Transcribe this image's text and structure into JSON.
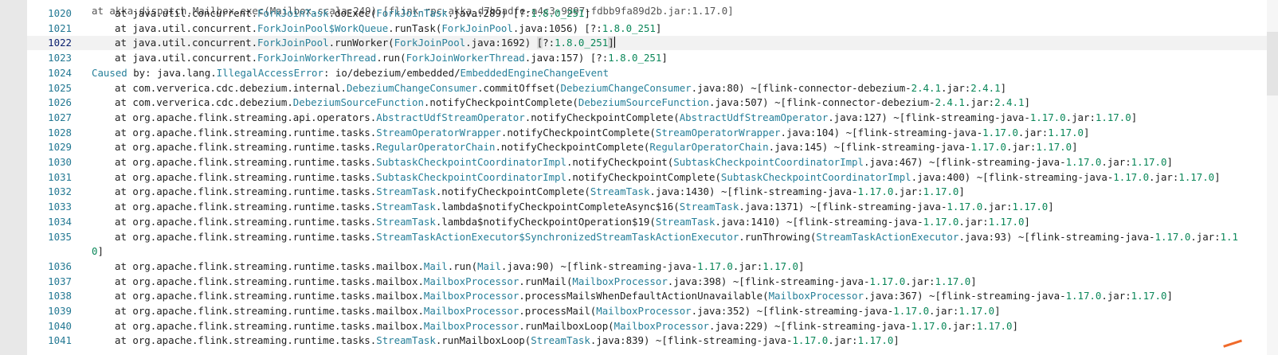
{
  "editor": {
    "top_fragment": "at akka.dispatch.Mailbox.exec(Mailbox.scala:249) [flink-rpc-akka_d7b5adfe-a4c3-9897-fdbb9fa89d2b.jar:1.17.0]",
    "lines": [
      {
        "num": "1020",
        "segs": [
          [
            "",
            "at java.util.concurrent."
          ],
          [
            "c",
            "ForkJoinTask"
          ],
          [
            "",
            ".doExec("
          ],
          [
            "c",
            "ForkJoinTask"
          ],
          [
            "",
            ".java:289) [?:"
          ],
          [
            "n",
            "1.8.0_251"
          ],
          [
            "",
            "]"
          ]
        ]
      },
      {
        "num": "1021",
        "segs": [
          [
            "",
            "at java.util.concurrent."
          ],
          [
            "c",
            "ForkJoinPool$WorkQueue"
          ],
          [
            "",
            ".runTask("
          ],
          [
            "c",
            "ForkJoinPool"
          ],
          [
            "",
            ".java:1056) [?:"
          ],
          [
            "n",
            "1.8.0_251"
          ],
          [
            "",
            "]"
          ]
        ]
      },
      {
        "num": "1022",
        "segs": [
          [
            "",
            "at java.util.concurrent."
          ],
          [
            "c",
            "ForkJoinPool"
          ],
          [
            "",
            ".runWorker("
          ],
          [
            "c",
            "ForkJoinPool"
          ],
          [
            "",
            ".java:1692) "
          ],
          [
            "hl",
            "["
          ],
          [
            "",
            "?:"
          ],
          [
            "n",
            "1.8.0_251"
          ],
          [
            "hl",
            "]"
          ]
        ]
      },
      {
        "num": "1023",
        "segs": [
          [
            "",
            "at java.util.concurrent."
          ],
          [
            "c",
            "ForkJoinWorkerThread"
          ],
          [
            "",
            ".run("
          ],
          [
            "c",
            "ForkJoinWorkerThread"
          ],
          [
            "",
            ".java:157) [?:"
          ],
          [
            "n",
            "1.8.0_251"
          ],
          [
            "",
            "]"
          ]
        ]
      },
      {
        "num": "1024",
        "noindent": true,
        "segs": [
          [
            "c",
            "Caused"
          ],
          [
            "",
            " by: java.lang."
          ],
          [
            "c",
            "IllegalAccessError"
          ],
          [
            "",
            ": io/debezium/embedded/"
          ],
          [
            "c",
            "EmbeddedEngineChangeEvent"
          ]
        ]
      },
      {
        "num": "1025",
        "segs": [
          [
            "",
            "at com.ververica.cdc.debezium.internal."
          ],
          [
            "c",
            "DebeziumChangeConsumer"
          ],
          [
            "",
            ".commitOffset("
          ],
          [
            "c",
            "DebeziumChangeConsumer"
          ],
          [
            "",
            ".java:80) ~[flink-connector-debezium-"
          ],
          [
            "n",
            "2.4.1"
          ],
          [
            "",
            ".jar:"
          ],
          [
            "n",
            "2.4.1"
          ],
          [
            "",
            "]"
          ]
        ]
      },
      {
        "num": "1026",
        "segs": [
          [
            "",
            "at com.ververica.cdc.debezium."
          ],
          [
            "c",
            "DebeziumSourceFunction"
          ],
          [
            "",
            ".notifyCheckpointComplete("
          ],
          [
            "c",
            "DebeziumSourceFunction"
          ],
          [
            "",
            ".java:507) ~[flink-connector-debezium-"
          ],
          [
            "n",
            "2.4.1"
          ],
          [
            "",
            ".jar:"
          ],
          [
            "n",
            "2.4.1"
          ],
          [
            "",
            "]"
          ]
        ]
      },
      {
        "num": "1027",
        "segs": [
          [
            "",
            "at org.apache.flink.streaming.api.operators."
          ],
          [
            "c",
            "AbstractUdfStreamOperator"
          ],
          [
            "",
            ".notifyCheckpointComplete("
          ],
          [
            "c",
            "AbstractUdfStreamOperator"
          ],
          [
            "",
            ".java:127) ~[flink-streaming-java-"
          ],
          [
            "n",
            "1.17.0"
          ],
          [
            "",
            ".jar:"
          ],
          [
            "n",
            "1.17.0"
          ],
          [
            "",
            "]"
          ]
        ]
      },
      {
        "num": "1028",
        "segs": [
          [
            "",
            "at org.apache.flink.streaming.runtime.tasks."
          ],
          [
            "c",
            "StreamOperatorWrapper"
          ],
          [
            "",
            ".notifyCheckpointComplete("
          ],
          [
            "c",
            "StreamOperatorWrapper"
          ],
          [
            "",
            ".java:104) ~[flink-streaming-java-"
          ],
          [
            "n",
            "1.17.0"
          ],
          [
            "",
            ".jar:"
          ],
          [
            "n",
            "1.17.0"
          ],
          [
            "",
            "]"
          ]
        ]
      },
      {
        "num": "1029",
        "segs": [
          [
            "",
            "at org.apache.flink.streaming.runtime.tasks."
          ],
          [
            "c",
            "RegularOperatorChain"
          ],
          [
            "",
            ".notifyCheckpointComplete("
          ],
          [
            "c",
            "RegularOperatorChain"
          ],
          [
            "",
            ".java:145) ~[flink-streaming-java-"
          ],
          [
            "n",
            "1.17.0"
          ],
          [
            "",
            ".jar:"
          ],
          [
            "n",
            "1.17.0"
          ],
          [
            "",
            "]"
          ]
        ]
      },
      {
        "num": "1030",
        "segs": [
          [
            "",
            "at org.apache.flink.streaming.runtime.tasks."
          ],
          [
            "c",
            "SubtaskCheckpointCoordinatorImpl"
          ],
          [
            "",
            ".notifyCheckpoint("
          ],
          [
            "c",
            "SubtaskCheckpointCoordinatorImpl"
          ],
          [
            "",
            ".java:467) ~[flink-streaming-java-"
          ],
          [
            "n",
            "1.17.0"
          ],
          [
            "",
            ".jar:"
          ],
          [
            "n",
            "1.17.0"
          ],
          [
            "",
            "]"
          ]
        ]
      },
      {
        "num": "1031",
        "segs": [
          [
            "",
            "at org.apache.flink.streaming.runtime.tasks."
          ],
          [
            "c",
            "SubtaskCheckpointCoordinatorImpl"
          ],
          [
            "",
            ".notifyCheckpointComplete("
          ],
          [
            "c",
            "SubtaskCheckpointCoordinatorImpl"
          ],
          [
            "",
            ".java:400) ~[flink-streaming-java-"
          ],
          [
            "n",
            "1.17.0"
          ],
          [
            "",
            ".jar:"
          ],
          [
            "n",
            "1.17.0"
          ],
          [
            "",
            "]"
          ]
        ]
      },
      {
        "num": "1032",
        "segs": [
          [
            "",
            "at org.apache.flink.streaming.runtime.tasks."
          ],
          [
            "c",
            "StreamTask"
          ],
          [
            "",
            ".notifyCheckpointComplete("
          ],
          [
            "c",
            "StreamTask"
          ],
          [
            "",
            ".java:1430) ~[flink-streaming-java-"
          ],
          [
            "n",
            "1.17.0"
          ],
          [
            "",
            ".jar:"
          ],
          [
            "n",
            "1.17.0"
          ],
          [
            "",
            "]"
          ]
        ]
      },
      {
        "num": "1033",
        "segs": [
          [
            "",
            "at org.apache.flink.streaming.runtime.tasks."
          ],
          [
            "c",
            "StreamTask"
          ],
          [
            "",
            ".lambda$notifyCheckpointCompleteAsync$16("
          ],
          [
            "c",
            "StreamTask"
          ],
          [
            "",
            ".java:1371) ~[flink-streaming-java-"
          ],
          [
            "n",
            "1.17.0"
          ],
          [
            "",
            ".jar:"
          ],
          [
            "n",
            "1.17.0"
          ],
          [
            "",
            "]"
          ]
        ]
      },
      {
        "num": "1034",
        "segs": [
          [
            "",
            "at org.apache.flink.streaming.runtime.tasks."
          ],
          [
            "c",
            "StreamTask"
          ],
          [
            "",
            ".lambda$notifyCheckpointOperation$19("
          ],
          [
            "c",
            "StreamTask"
          ],
          [
            "",
            ".java:1410) ~[flink-streaming-java-"
          ],
          [
            "n",
            "1.17.0"
          ],
          [
            "",
            ".jar:"
          ],
          [
            "n",
            "1.17.0"
          ],
          [
            "",
            "]"
          ]
        ]
      },
      {
        "num": "1035",
        "segs": [
          [
            "",
            "at org.apache.flink.streaming.runtime.tasks."
          ],
          [
            "c",
            "StreamTaskActionExecutor$SynchronizedStreamTaskActionExecutor"
          ],
          [
            "",
            ".runThrowing("
          ],
          [
            "c",
            "StreamTaskActionExecutor"
          ],
          [
            "",
            ".java:93) ~[flink-streaming-java-"
          ],
          [
            "n",
            "1.17.0"
          ],
          [
            "",
            ".jar:"
          ],
          [
            "n",
            "1.1"
          ]
        ],
        "wrap": [
          [
            "n",
            "0"
          ],
          [
            "",
            "]"
          ]
        ]
      },
      {
        "num": "1036",
        "segs": [
          [
            "",
            "at org.apache.flink.streaming.runtime.tasks.mailbox."
          ],
          [
            "c",
            "Mail"
          ],
          [
            "",
            ".run("
          ],
          [
            "c",
            "Mail"
          ],
          [
            "",
            ".java:90) ~[flink-streaming-java-"
          ],
          [
            "n",
            "1.17.0"
          ],
          [
            "",
            ".jar:"
          ],
          [
            "n",
            "1.17.0"
          ],
          [
            "",
            "]"
          ]
        ]
      },
      {
        "num": "1037",
        "segs": [
          [
            "",
            "at org.apache.flink.streaming.runtime.tasks.mailbox."
          ],
          [
            "c",
            "MailboxProcessor"
          ],
          [
            "",
            ".runMail("
          ],
          [
            "c",
            "MailboxProcessor"
          ],
          [
            "",
            ".java:398) ~[flink-streaming-java-"
          ],
          [
            "n",
            "1.17.0"
          ],
          [
            "",
            ".jar:"
          ],
          [
            "n",
            "1.17.0"
          ],
          [
            "",
            "]"
          ]
        ]
      },
      {
        "num": "1038",
        "segs": [
          [
            "",
            "at org.apache.flink.streaming.runtime.tasks.mailbox."
          ],
          [
            "c",
            "MailboxProcessor"
          ],
          [
            "",
            ".processMailsWhenDefaultActionUnavailable("
          ],
          [
            "c",
            "MailboxProcessor"
          ],
          [
            "",
            ".java:367) ~[flink-streaming-java-"
          ],
          [
            "n",
            "1.17.0"
          ],
          [
            "",
            ".jar:"
          ],
          [
            "n",
            "1.17.0"
          ],
          [
            "",
            "]"
          ]
        ]
      },
      {
        "num": "1039",
        "segs": [
          [
            "",
            "at org.apache.flink.streaming.runtime.tasks.mailbox."
          ],
          [
            "c",
            "MailboxProcessor"
          ],
          [
            "",
            ".processMail("
          ],
          [
            "c",
            "MailboxProcessor"
          ],
          [
            "",
            ".java:352) ~[flink-streaming-java-"
          ],
          [
            "n",
            "1.17.0"
          ],
          [
            "",
            ".jar:"
          ],
          [
            "n",
            "1.17.0"
          ],
          [
            "",
            "]"
          ]
        ]
      },
      {
        "num": "1040",
        "segs": [
          [
            "",
            "at org.apache.flink.streaming.runtime.tasks.mailbox."
          ],
          [
            "c",
            "MailboxProcessor"
          ],
          [
            "",
            ".runMailboxLoop("
          ],
          [
            "c",
            "MailboxProcessor"
          ],
          [
            "",
            ".java:229) ~[flink-streaming-java-"
          ],
          [
            "n",
            "1.17.0"
          ],
          [
            "",
            ".jar:"
          ],
          [
            "n",
            "1.17.0"
          ],
          [
            "",
            "]"
          ]
        ]
      },
      {
        "num": "1041",
        "segs": [
          [
            "",
            "at org.apache.flink.streaming.runtime.tasks."
          ],
          [
            "c",
            "StreamTask"
          ],
          [
            "",
            ".runMailboxLoop("
          ],
          [
            "c",
            "StreamTask"
          ],
          [
            "",
            ".java:839) ~[flink-streaming-java-"
          ],
          [
            "n",
            "1.17.0"
          ],
          [
            "",
            ".jar:"
          ],
          [
            "n",
            "1.17.0"
          ],
          [
            "",
            "]"
          ]
        ]
      }
    ]
  }
}
